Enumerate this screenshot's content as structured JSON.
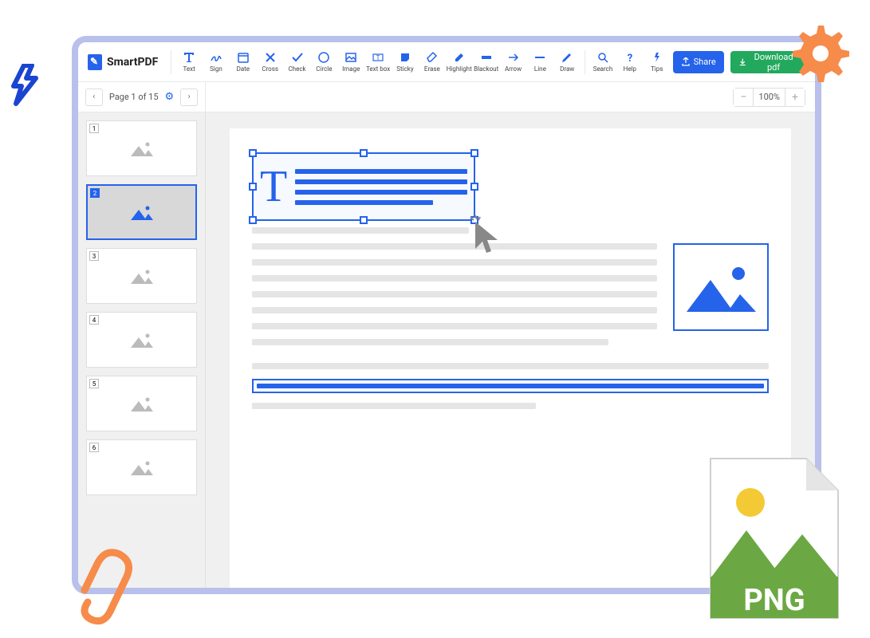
{
  "brand": "SmartPDF",
  "tools": [
    {
      "label": "Text",
      "icon": "text"
    },
    {
      "label": "Sign",
      "icon": "sign"
    },
    {
      "label": "Date",
      "icon": "date"
    },
    {
      "label": "Cross",
      "icon": "cross"
    },
    {
      "label": "Check",
      "icon": "check"
    },
    {
      "label": "Circle",
      "icon": "circle"
    },
    {
      "label": "Image",
      "icon": "image"
    },
    {
      "label": "Text box",
      "icon": "textbox"
    },
    {
      "label": "Sticky",
      "icon": "sticky"
    },
    {
      "label": "Erase",
      "icon": "erase"
    },
    {
      "label": "Highlight",
      "icon": "highlight"
    },
    {
      "label": "Blackout",
      "icon": "blackout"
    },
    {
      "label": "Arrow",
      "icon": "arrow"
    },
    {
      "label": "Line",
      "icon": "line"
    },
    {
      "label": "Draw",
      "icon": "draw"
    }
  ],
  "right_tools": [
    {
      "label": "Search",
      "icon": "search"
    },
    {
      "label": "Help",
      "icon": "help"
    },
    {
      "label": "Tips",
      "icon": "tips"
    }
  ],
  "share_label": "Share",
  "download_label": "Download pdf",
  "page_indicator": "Page 1 of 15",
  "zoom_value": "100%",
  "thumbnails": [
    {
      "num": "1",
      "selected": false
    },
    {
      "num": "2",
      "selected": true
    },
    {
      "num": "3",
      "selected": false
    },
    {
      "num": "4",
      "selected": false
    },
    {
      "num": "5",
      "selected": false
    },
    {
      "num": "6",
      "selected": false
    }
  ],
  "png_badge": "PNG"
}
